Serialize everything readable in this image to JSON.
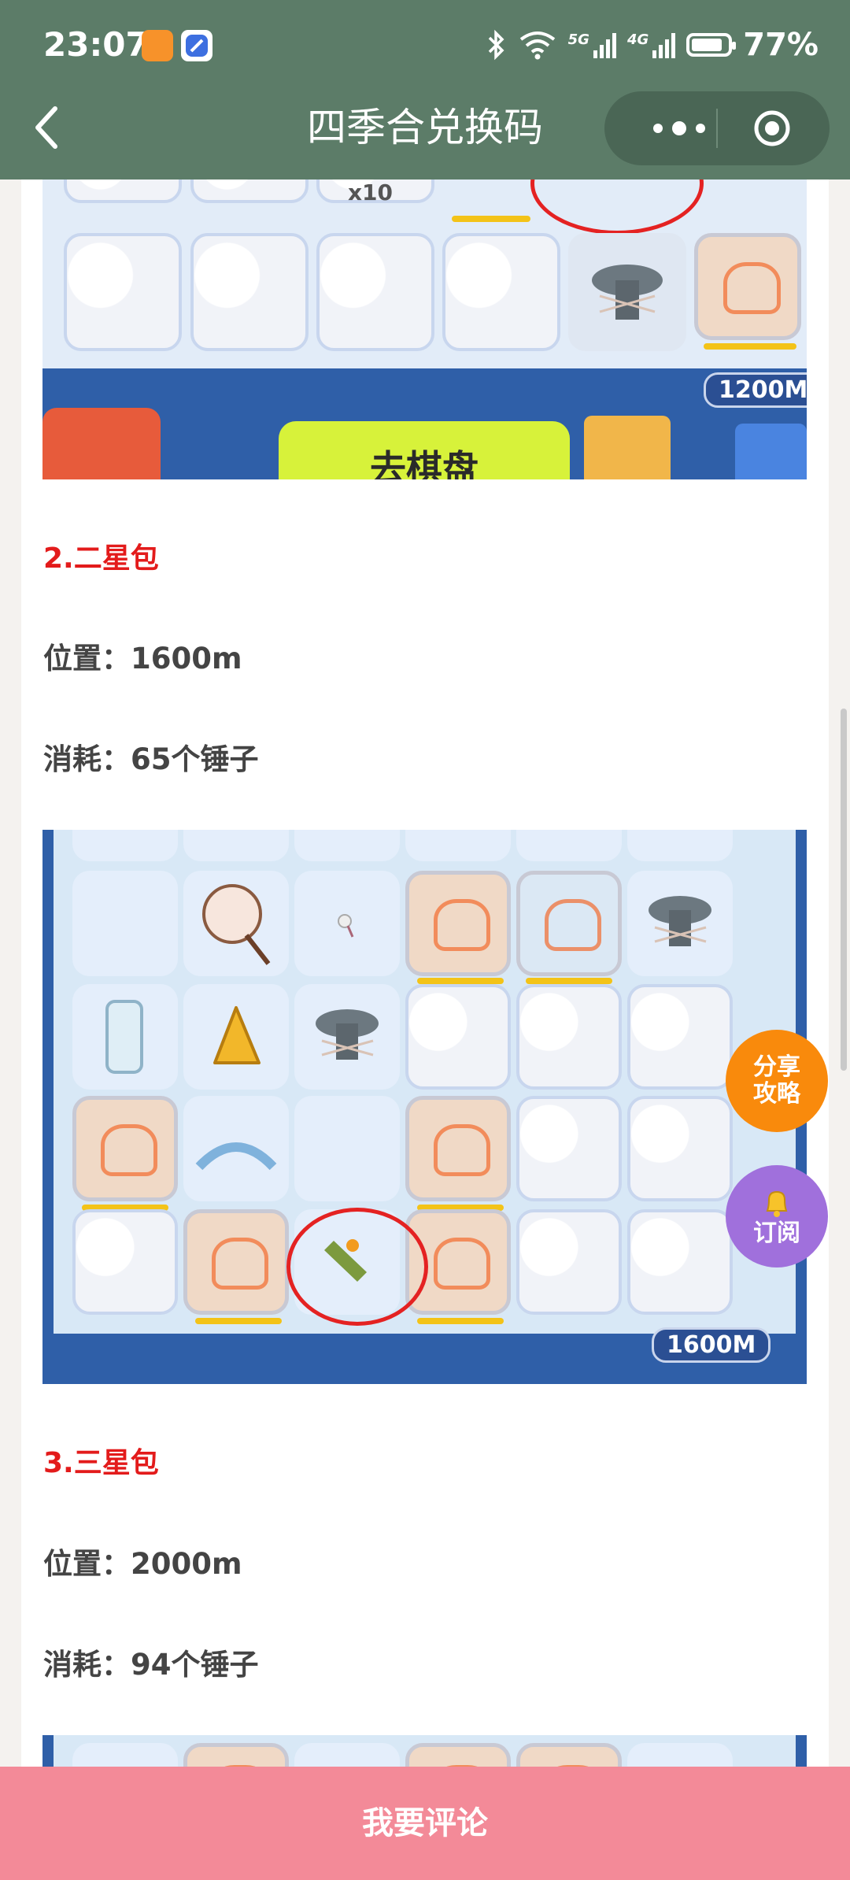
{
  "status_bar": {
    "time": "23:07",
    "battery": "77%",
    "net_5g": "5G",
    "net_4g": "4G",
    "battery_level": 0.77
  },
  "header": {
    "title": "四季合兑换码"
  },
  "article": {
    "item2_heading": "2.二星包",
    "item2_location": "位置：1600m",
    "item2_cost": "消耗：65个锤子",
    "item3_heading": "3.三星包",
    "item3_location": "位置：2000m",
    "item3_cost": "消耗：94个锤子",
    "shot1_distance": "1200M",
    "shot1_button": "去棋盘",
    "shot1_multiplier": "x10",
    "shot2_distance": "1600M"
  },
  "floating": {
    "share_line1": "分享",
    "share_line2": "攻略",
    "subscribe_label": "订阅"
  },
  "footer": {
    "comment_label": "我要评论"
  },
  "colors": {
    "header_bg": "#5c7c68",
    "heading_red": "#e31b1b",
    "footer_pink": "#f38a98",
    "share_orange": "#f98a0c",
    "subscribe_purple": "#a070dc"
  }
}
